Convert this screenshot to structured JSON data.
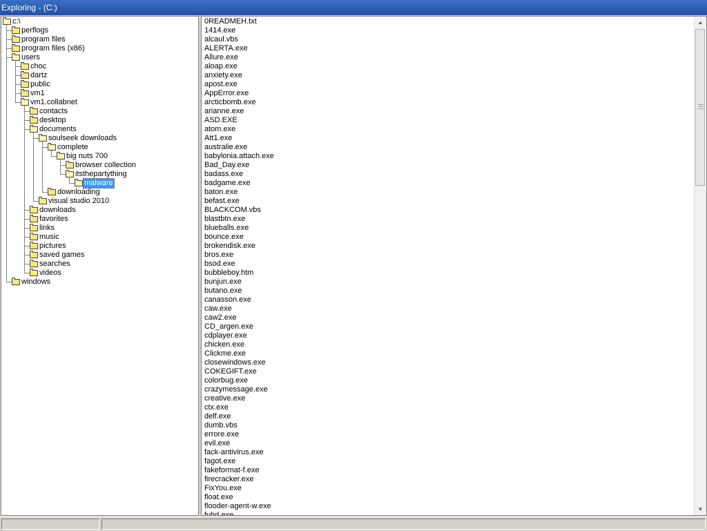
{
  "window": {
    "title": "Exploring - (C:)"
  },
  "tree": [
    {
      "label": "c:\\",
      "depth": 0,
      "open": true
    },
    {
      "label": "perflogs",
      "depth": 1
    },
    {
      "label": "program files",
      "depth": 1
    },
    {
      "label": "program files (x86)",
      "depth": 1
    },
    {
      "label": "users",
      "depth": 1,
      "open": true
    },
    {
      "label": "choc",
      "depth": 2
    },
    {
      "label": "dartz",
      "depth": 2
    },
    {
      "label": "public",
      "depth": 2
    },
    {
      "label": "vm1",
      "depth": 2
    },
    {
      "label": "vm1.collabnet",
      "depth": 2,
      "open": true
    },
    {
      "label": "contacts",
      "depth": 3
    },
    {
      "label": "desktop",
      "depth": 3
    },
    {
      "label": "documents",
      "depth": 3,
      "open": true
    },
    {
      "label": "soulseek downloads",
      "depth": 4,
      "open": true
    },
    {
      "label": "complete",
      "depth": 5,
      "open": true
    },
    {
      "label": "big nuts 700",
      "depth": 6,
      "open": true
    },
    {
      "label": "browser collection",
      "depth": 7
    },
    {
      "label": "itsthepartything",
      "depth": 7,
      "open": true
    },
    {
      "label": "malware",
      "depth": 8,
      "open": true,
      "selected": true
    },
    {
      "label": "downloading",
      "depth": 5
    },
    {
      "label": "visual studio 2010",
      "depth": 4
    },
    {
      "label": "downloads",
      "depth": 3
    },
    {
      "label": "favorites",
      "depth": 3
    },
    {
      "label": "links",
      "depth": 3
    },
    {
      "label": "music",
      "depth": 3
    },
    {
      "label": "pictures",
      "depth": 3
    },
    {
      "label": "saved games",
      "depth": 3
    },
    {
      "label": "searches",
      "depth": 3
    },
    {
      "label": "videos",
      "depth": 3
    },
    {
      "label": "windows",
      "depth": 1
    }
  ],
  "files": [
    "0READMEH.txt",
    "1414.exe",
    "alcaul.vbs",
    "ALERTA.exe",
    "Allure.exe",
    "aloap.exe",
    "anxiety.exe",
    "apost.exe",
    "AppError.exe",
    "arcticbomb.exe",
    "arianne.exe",
    "ASD.EXE",
    "atom.exe",
    "Att1.exe",
    "australie.exe",
    "babylonia.attach.exe",
    "Bad_Day.exe",
    "badass.exe",
    "badgame.exe",
    "baton.exe",
    "befast.exe",
    "BLACKCOM.vbs",
    "blastbtn.exe",
    "blueballs.exe",
    "bounce.exe",
    "brokendisk.exe",
    "bros.exe",
    "bsod.exe",
    "bubbleboy.htm",
    "bunjun.exe",
    "butano.exe",
    "canasson.exe",
    "caw.exe",
    "caw2.exe",
    "CD_argen.exe",
    "cdplayer.exe",
    "chicken.exe",
    "Clickme.exe",
    "closewindows.exe",
    "COKEGIFT.exe",
    "colorbug.exe",
    "crazymessage.exe",
    "creative.exe",
    "ctx.exe",
    "delf.exe",
    "dumb.vbs",
    "errore.exe",
    "evil.exe",
    "fack-antivirus.exe",
    "fagot.exe",
    "fakeformat-f.exe",
    "firecracker.exe",
    "FixYou.exe",
    "float.exe",
    "flooder-agent-w.exe",
    "fuhd.exe"
  ],
  "statusbar": {
    "left": "",
    "right": ""
  }
}
